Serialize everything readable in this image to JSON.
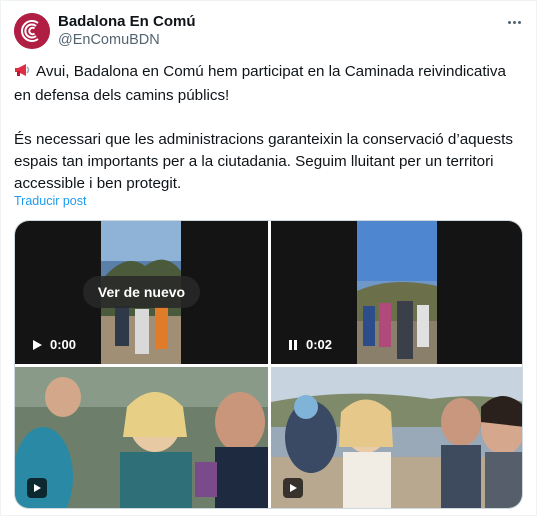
{
  "author": {
    "name": "Badalona En Comú",
    "handle": "@EnComuBDN",
    "avatar_color": "#b01e43"
  },
  "tweet": {
    "emoji_icon": "megaphone-icon",
    "line1": "Avui, Badalona en Comú hem participat en la Caminada reivindicativa en defensa dels camins públics!",
    "line2": "És necessari que les administracions garanteixin la conservació d’aquests espais tan importants per a la ciutadania. Seguim lluitant per un territori accessible i ben protegit.",
    "translate_label": "Traducir post"
  },
  "media": {
    "video1": {
      "replay_label": "Ver de nuevo",
      "time": "0:00",
      "control_icon": "play-icon"
    },
    "video2": {
      "time": "0:02",
      "control_icon": "pause-icon"
    },
    "video3": {
      "control_icon": "play-icon"
    },
    "video4": {
      "control_icon": "play-icon"
    }
  },
  "colors": {
    "text": "#0f1419",
    "secondary": "#536471",
    "link": "#1d9bf0",
    "border": "#cfd9de"
  }
}
